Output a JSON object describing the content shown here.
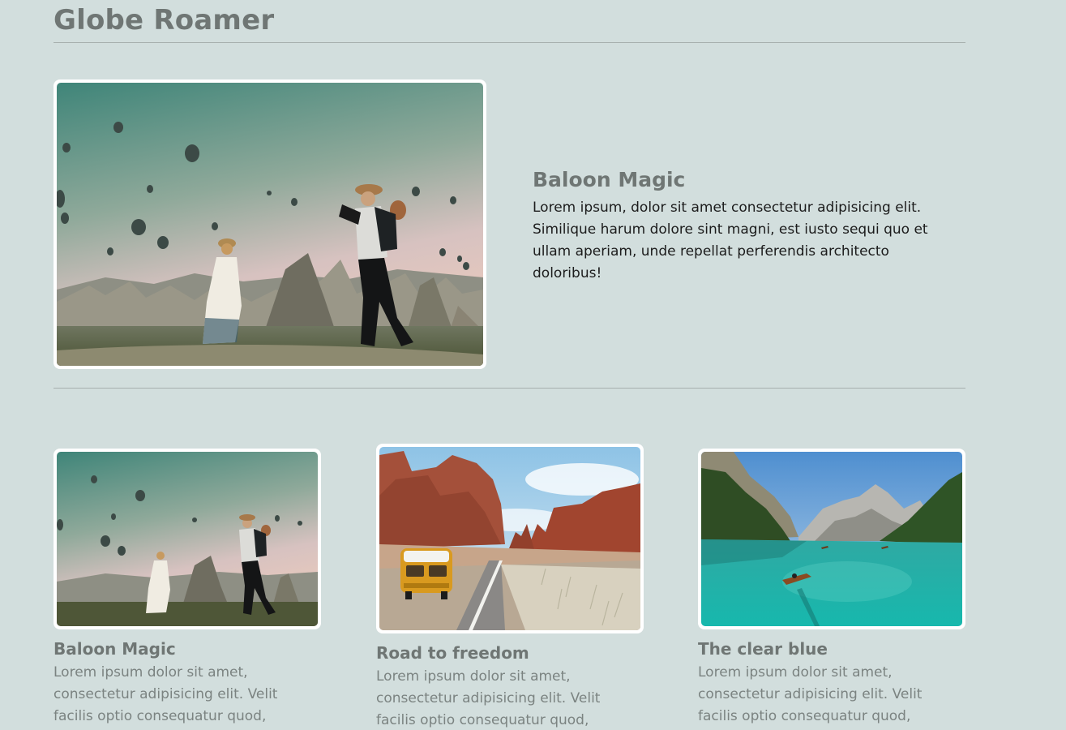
{
  "header": {
    "title": "Globe Roamer"
  },
  "featured": {
    "title": "Baloon Magic",
    "body": "Lorem ipsum, dolor sit amet consectetur adipisicing elit. Similique harum dolore sint magni, est iusto sequi quo et ullam aperiam, unde repellat perferendis architecto doloribus!"
  },
  "cards": [
    {
      "title": "Baloon Magic",
      "body": "Lorem ipsum dolor sit amet, consectetur adipisicing elit. Velit facilis optio consequatur quod,"
    },
    {
      "title": "Road to freedom",
      "body": "Lorem ipsum dolor sit amet, consectetur adipisicing elit. Velit facilis optio consequatur quod,"
    },
    {
      "title": "The clear blue",
      "body": "Lorem ipsum dolor sit amet, consectetur adipisicing elit. Velit facilis optio consequatur quod,"
    }
  ],
  "colors": {
    "background": "#d2dedd",
    "heading": "#6f7674",
    "body_text": "#1c1c1c",
    "muted_text": "#7b8381",
    "frame": "#ffffff"
  }
}
